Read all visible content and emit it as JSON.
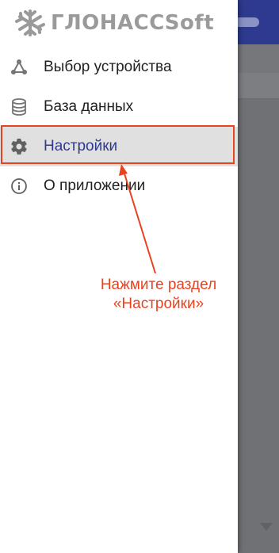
{
  "app": {
    "brand_text": "ГЛОНАССSoft"
  },
  "menu": {
    "items": [
      {
        "label": "Выбор устройства",
        "icon": "graph-nodes-icon"
      },
      {
        "label": "База данных",
        "icon": "database-icon"
      },
      {
        "label": "Настройки",
        "icon": "gear-icon",
        "active": true
      },
      {
        "label": "О приложении",
        "icon": "info-icon"
      }
    ]
  },
  "annotation": {
    "line1": "Нажмите раздел",
    "line2": "«Настройки»"
  },
  "colors": {
    "accent": "#2e3a8f",
    "annotation": "#e8431f",
    "logo": "#9a9a9a"
  }
}
